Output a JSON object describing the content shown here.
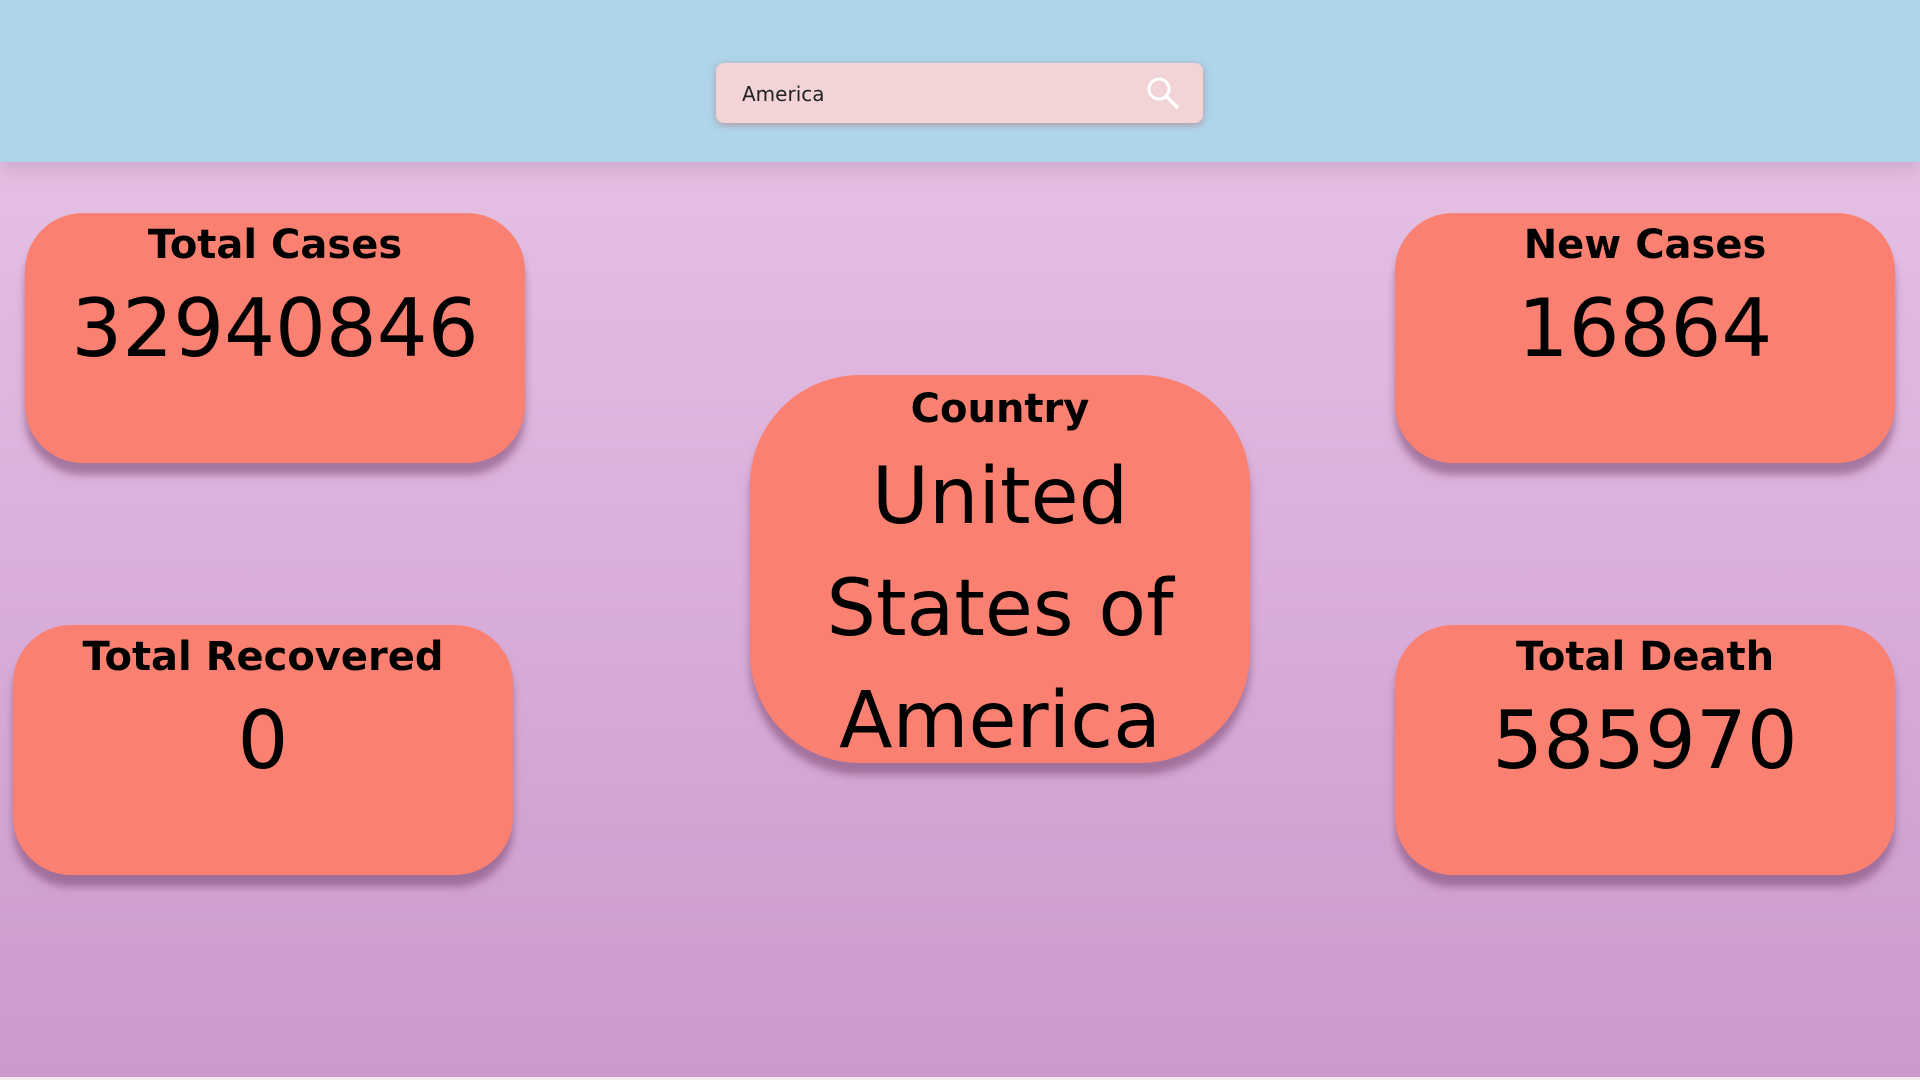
{
  "search": {
    "value": "America",
    "icon": "search-icon"
  },
  "cards": {
    "total_cases": {
      "label": "Total Cases",
      "value": "32940846"
    },
    "new_cases": {
      "label": "New Cases",
      "value": "16864"
    },
    "country": {
      "label": "Country",
      "value": "United States of America"
    },
    "total_recovered": {
      "label": "Total Recovered",
      "value": "0"
    },
    "total_death": {
      "label": "Total Death",
      "value": "585970"
    }
  },
  "colors": {
    "header_bg": "#aed5ea",
    "card_bg": "#fa8072",
    "search_bg": "#f2d4d6",
    "page_gradient_top": "#e9c6e6",
    "page_gradient_bottom": "#cc99cb"
  }
}
